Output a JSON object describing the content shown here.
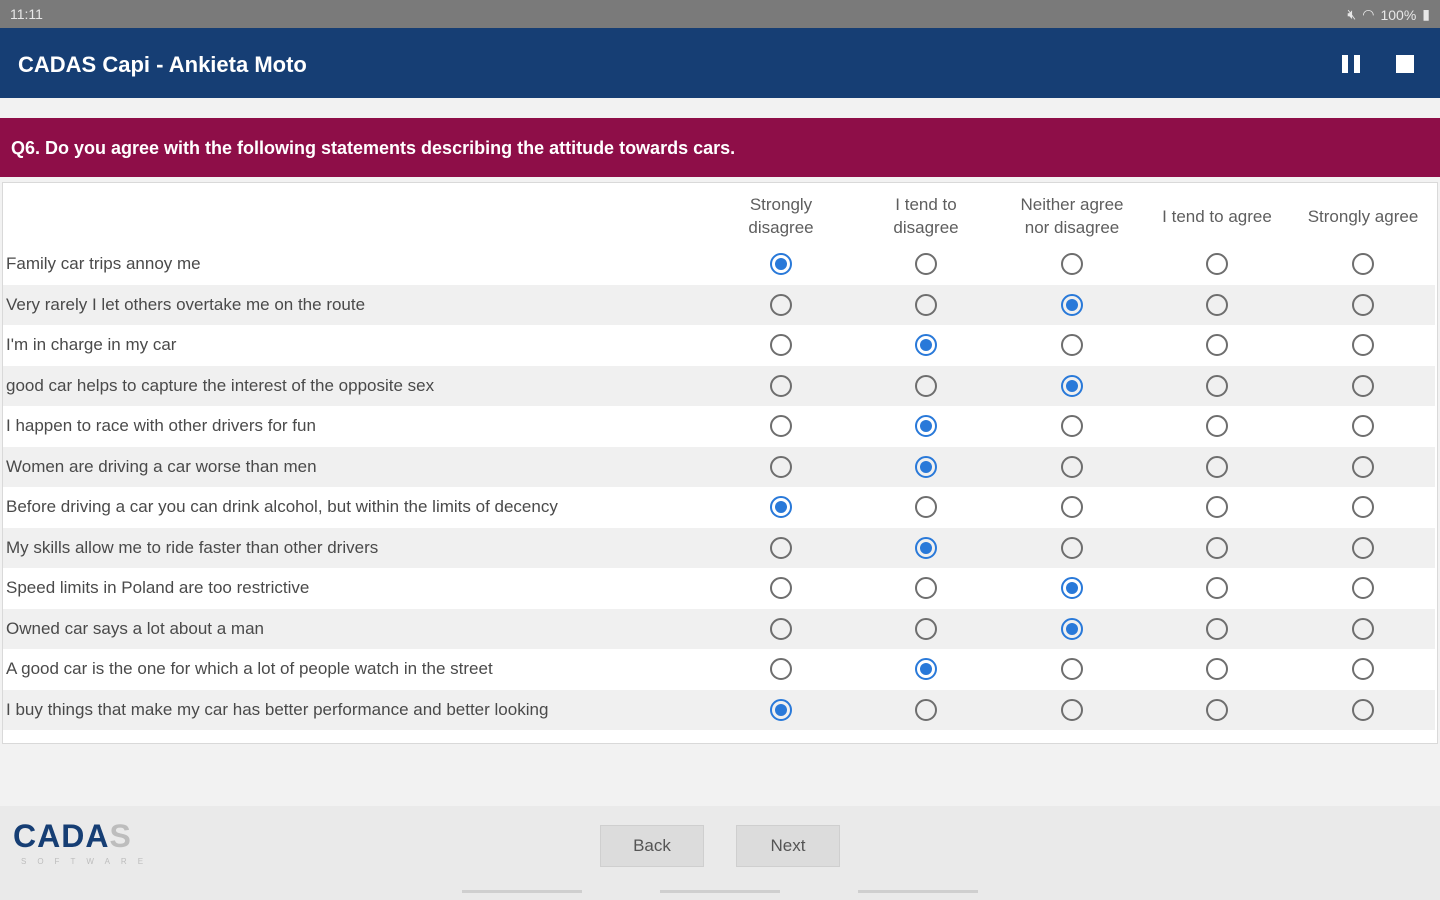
{
  "status_bar": {
    "time": "11:11",
    "battery": "100%"
  },
  "app_bar": {
    "title": "CADAS Capi - Ankieta Moto"
  },
  "question": {
    "text": "Q6. Do you agree with the following statements describing the attitude towards cars."
  },
  "columns": [
    {
      "line1": "Strongly",
      "line2": "disagree"
    },
    {
      "line1": "I tend to",
      "line2": "disagree"
    },
    {
      "line1": "Neither agree",
      "line2": "nor disagree"
    },
    {
      "line1": "I tend to agree",
      "line2": ""
    },
    {
      "line1": "Strongly agree",
      "line2": ""
    }
  ],
  "rows": [
    {
      "label": "Family car trips annoy me",
      "selected": 0
    },
    {
      "label": "Very rarely I let others overtake me on the route",
      "selected": 2
    },
    {
      "label": "I'm in charge in my car",
      "selected": 1
    },
    {
      "label": "good car helps to capture the interest of the opposite sex",
      "selected": 2
    },
    {
      "label": "I happen to race with other drivers for fun",
      "selected": 1
    },
    {
      "label": "Women are driving a car worse than men",
      "selected": 1
    },
    {
      "label": "Before driving a car you can drink alcohol, but within the limits of decency",
      "selected": 0
    },
    {
      "label": "My skills allow me to ride faster than other drivers",
      "selected": 1
    },
    {
      "label": "Speed limits in Poland are too restrictive",
      "selected": 2
    },
    {
      "label": "Owned car says a lot about a man",
      "selected": 2
    },
    {
      "label": "A good car is the one for which a lot of people watch in the street",
      "selected": 1
    },
    {
      "label": "I buy things that make my car has better performance and better looking",
      "selected": 0
    }
  ],
  "footer": {
    "logo_main": "CADA",
    "logo_last": "S",
    "logo_sub": "SOFTWARE",
    "back_label": "Back",
    "next_label": "Next"
  },
  "colors": {
    "app_bar": "#163e74",
    "question_bar": "#8e0e48",
    "radio_checked": "#2979d9"
  }
}
